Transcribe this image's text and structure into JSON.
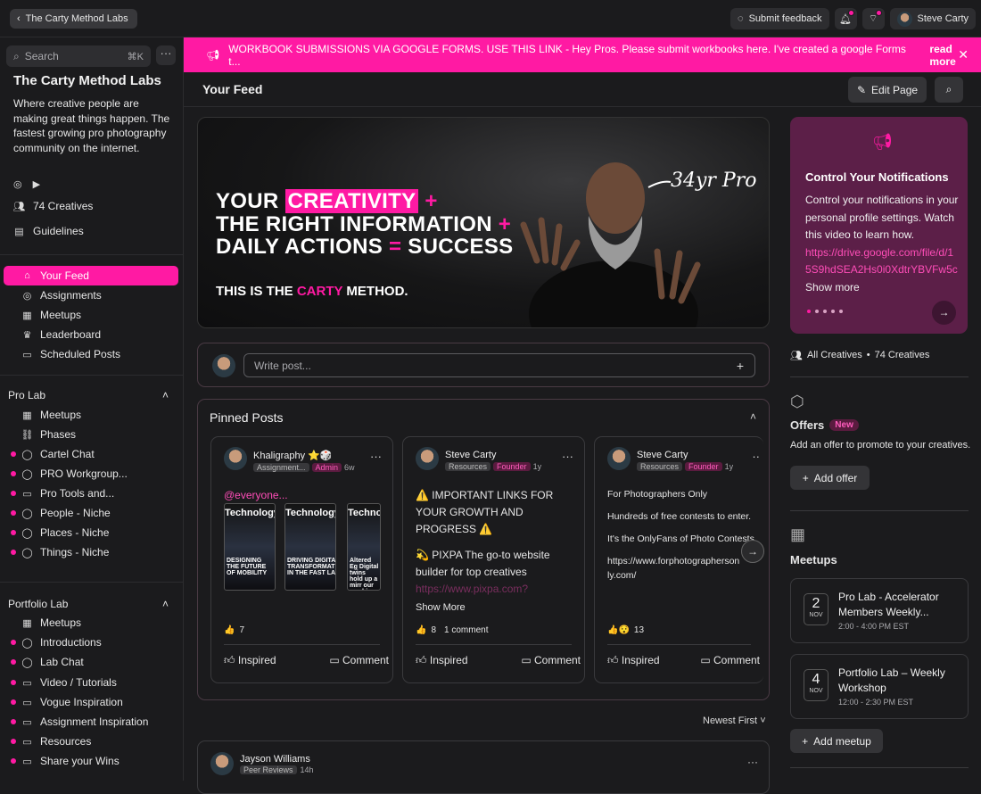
{
  "topbar": {
    "back_label": "The Carty Method Labs",
    "feedback_label": "Submit feedback",
    "user_name": "Steve Carty"
  },
  "sidebar": {
    "search_placeholder": "Search",
    "search_shortcut": "⌘K",
    "more_label": "···",
    "brand_title": "The Carty Method Labs",
    "brand_desc": "Where creative people are making great things happen. The fastest growing pro photography community on the internet.",
    "creatives": "74 Creatives",
    "guidelines": "Guidelines",
    "main_nav": [
      {
        "label": "Your Feed",
        "icon": "home-icon"
      },
      {
        "label": "Assignments",
        "icon": "target-icon"
      },
      {
        "label": "Meetups",
        "icon": "calendar-icon"
      },
      {
        "label": "Leaderboard",
        "icon": "trophy-icon"
      },
      {
        "label": "Scheduled Posts",
        "icon": "monitor-icon"
      }
    ],
    "pro_lab": {
      "title": "Pro Lab",
      "items": [
        "Meetups",
        "Phases",
        "Cartel Chat",
        "PRO Workgroup...",
        "Pro Tools and...",
        "People - Niche",
        "Places - Niche",
        "Things - Niche"
      ]
    },
    "portfolio_lab": {
      "title": "Portfolio Lab",
      "items": [
        "Meetups",
        "Introductions",
        "Lab Chat",
        "Video / Tutorials",
        "Vogue Inspiration",
        "Assignment Inspiration",
        "Resources",
        "Share your Wins"
      ]
    }
  },
  "banner": {
    "text": "WORKBOOK SUBMISSIONS VIA GOOGLE FORMS. USE THIS LINK - Hey Pros. Please submit workbooks here. I've created a google Forms t...",
    "read_more": "read more"
  },
  "feed": {
    "title": "Your Feed",
    "edit_label": "Edit Page",
    "hero": {
      "line1a": "YOUR ",
      "line1b": "CREATIVITY",
      "line1c": " +",
      "line2a": "THE RIGHT INFORMATION ",
      "line2b": "+",
      "line3a": "DAILY ACTIONS ",
      "line3b": "=",
      "line3c": " SUCCESS",
      "line4a": "THIS IS THE ",
      "line4b": "CARTY",
      "line4c": " METHOD.",
      "script": "34yr Pro"
    },
    "write_placeholder": "Write post...",
    "pinned_title": "Pinned Posts",
    "pinned": [
      {
        "name": "Khaligraphy ⭐🎲",
        "space": "Assignment...",
        "role": "Admin",
        "age": "6w",
        "text": "@everyone...",
        "reactions": "7",
        "comments": ""
      },
      {
        "name": "Steve Carty",
        "space": "Resources",
        "role": "Founder",
        "age": "1y",
        "text1": "⚠️ IMPORTANT LINKS FOR YOUR GROWTH AND PROGRESS ⚠️",
        "text2": "💫 PIXPA The go-to website builder for top creatives",
        "link": "https://www.pixpa.com?",
        "show_more": "Show More",
        "reactions": "8",
        "comments": "1 comment"
      },
      {
        "name": "Steve Carty",
        "space": "Resources",
        "role": "Founder",
        "age": "1y",
        "text1": "For Photographers Only",
        "text2": "Hundreds of free contests to enter.",
        "text3": "It's the OnlyFans of Photo Contests",
        "text4": "https://www.forphotographersonly.com/",
        "reactions": "13",
        "comments": ""
      }
    ],
    "action_inspired": "Inspired",
    "action_comment": "Comment",
    "sort_label": "Newest First",
    "post": {
      "name": "Jayson Williams",
      "space": "Peer Reviews",
      "age": "14h"
    }
  },
  "right": {
    "notif_title": "Control Your Notifications",
    "notif_text": "Control your notifications in your personal profile settings. Watch this video to learn how.",
    "notif_link": "https://drive.google.com/file/d/15S9hdSEA2Hs0i0XdtrYBVFw5c",
    "notif_more": "Show more",
    "all_creatives": "All Creatives",
    "creatives_count": "74 Creatives",
    "offers_title": "Offers",
    "offers_badge": "New",
    "offers_desc": "Add an offer to promote to your creatives.",
    "add_offer": "Add offer",
    "meetups_title": "Meetups",
    "meetups": [
      {
        "day": "2",
        "month": "NOV",
        "title": "Pro Lab - Accelerator Members Weekly...",
        "time": "2:00 - 4:00 PM EST"
      },
      {
        "day": "4",
        "month": "NOV",
        "title": "Portfolio Lab – Weekly Workshop",
        "time": "12:00 - 2:30 PM EST"
      }
    ],
    "add_meetup": "Add meetup"
  },
  "thumbs": [
    "Technology",
    "Technology",
    "Technol"
  ],
  "thumb_subs": [
    "DESIGNING THE FUTURE OF MOBILITY",
    "DRIVING DIGITAL TRANSFORMATION IN THE FAST LANE",
    "Altered Eg Digital twins hold up a mirr our machines"
  ]
}
